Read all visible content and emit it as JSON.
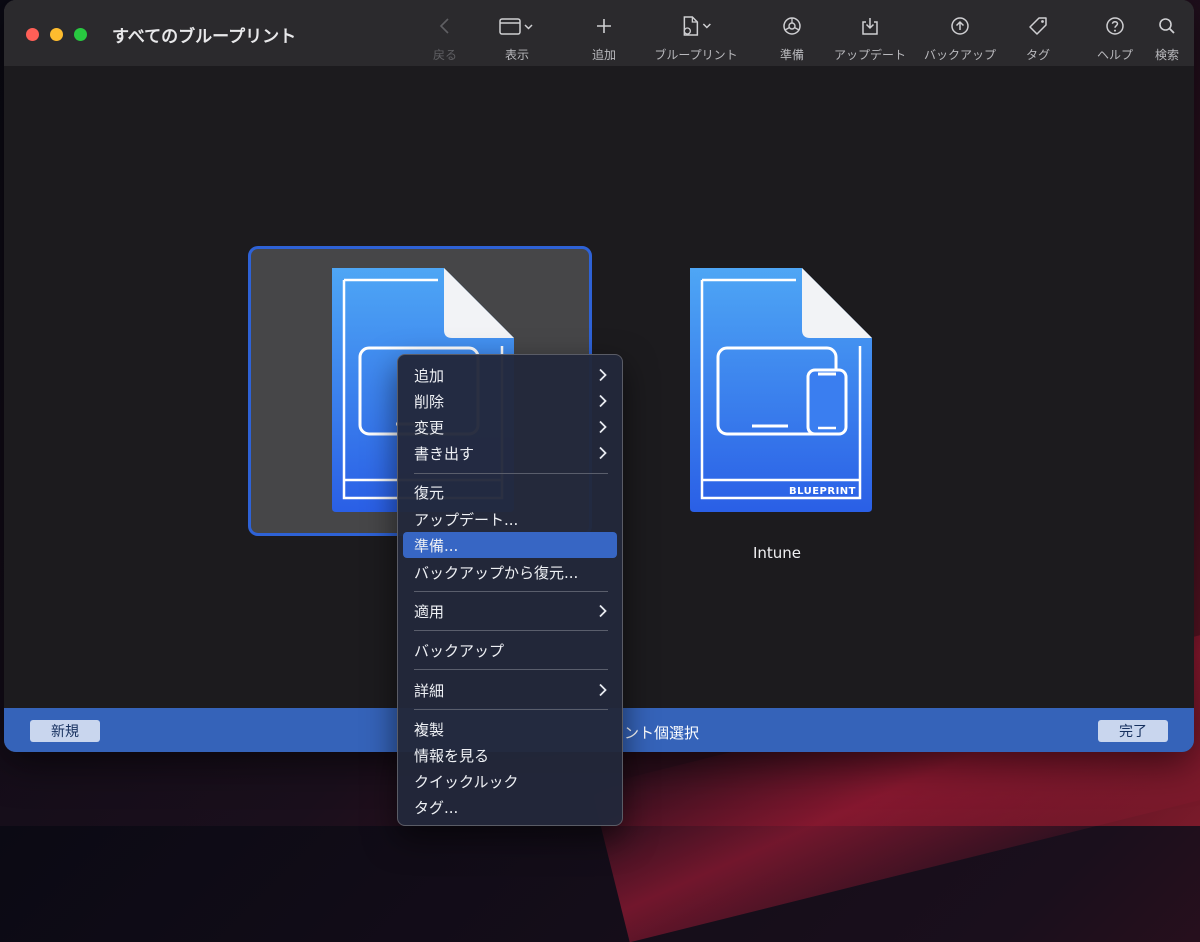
{
  "window": {
    "title": "すべてのブループリント"
  },
  "toolbar": {
    "back": "戻る",
    "view": "表示",
    "add": "追加",
    "blueprint": "ブループリント",
    "prepare": "準備",
    "update": "アップデート",
    "backup": "バックアップ",
    "tag": "タグ",
    "help": "ヘルプ",
    "search": "検索"
  },
  "documents": [
    {
      "name": "",
      "selected": true
    },
    {
      "name": "Intune",
      "badge": "BLUEPRINT",
      "selected": false
    }
  ],
  "bottom_bar": {
    "new_button": "新規",
    "status": "ント個選択",
    "done_button": "完了"
  },
  "context_menu": {
    "items": [
      {
        "label": "追加",
        "submenu": true
      },
      {
        "label": "削除",
        "submenu": true
      },
      {
        "label": "変更",
        "submenu": true
      },
      {
        "label": "書き出す",
        "submenu": true
      },
      {
        "label": "復元",
        "submenu": false
      },
      {
        "label": "アップデート...",
        "submenu": false
      },
      {
        "label": "準備...",
        "submenu": false,
        "highlighted": true
      },
      {
        "label": "バックアップから復元...",
        "submenu": false
      },
      {
        "label": "適用",
        "submenu": true
      },
      {
        "label": "バックアップ",
        "submenu": false
      },
      {
        "label": "詳細",
        "submenu": true
      },
      {
        "label": "複製",
        "submenu": false
      },
      {
        "label": "情報を見る",
        "submenu": false
      },
      {
        "label": "クイックルック",
        "submenu": false
      },
      {
        "label": "タグ...",
        "submenu": false
      }
    ]
  },
  "colors": {
    "accent": "#3766c4",
    "doc_gradient_top": "#4ea6f5",
    "doc_gradient_bottom": "#2a5fe6",
    "bottom_bar": "#3563b9"
  }
}
